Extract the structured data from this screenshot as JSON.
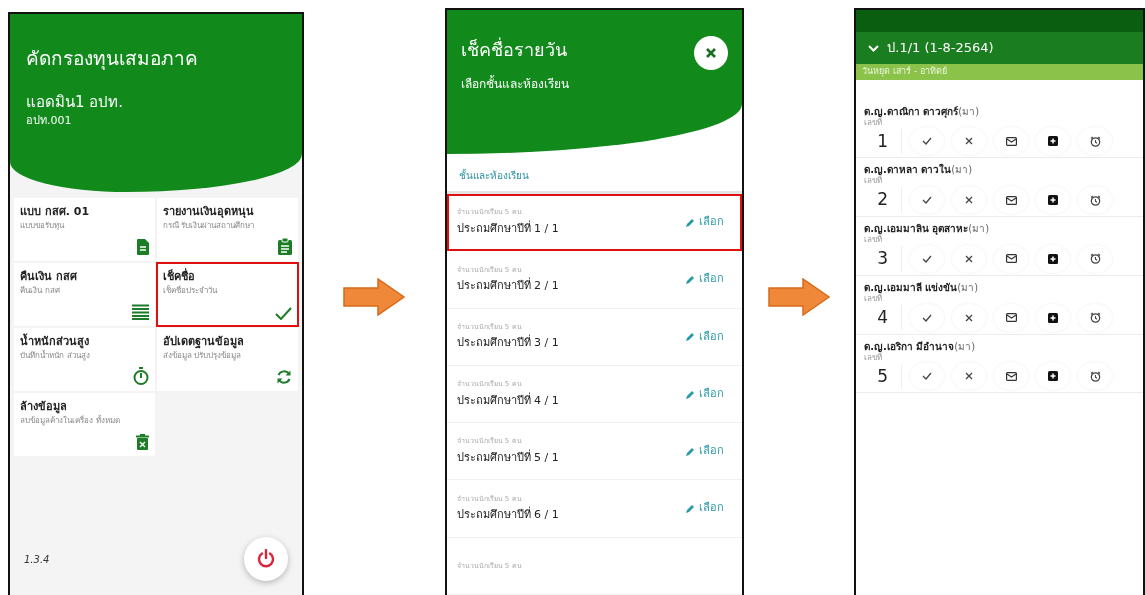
{
  "screens": [
    {
      "kind": "menu",
      "title": "คัดกรองทุนเสมอภาค",
      "user": "แอดมิน1 อปท.",
      "org": "อปท.001",
      "tiles": [
        {
          "title": "แบบ กสศ. 01",
          "subtitle": "แบบขอรับทุน",
          "highlighted": false
        },
        {
          "title": "รายงานเงินอุดหนุน",
          "subtitle": "กรณี รับเงินผ่านสถานศึกษา",
          "highlighted": false
        },
        {
          "title": "คืนเงิน กสศ",
          "subtitle": "คืนเงิน กสศ",
          "highlighted": false
        },
        {
          "title": "เช็คชื่อ",
          "subtitle": "เช็คชื่อประจำวัน",
          "highlighted": true
        },
        {
          "title": "น้ำหนักส่วนสูง",
          "subtitle": "บันทึกน้ำหนัก ส่วนสูง",
          "highlighted": false
        },
        {
          "title": "อัปเดตฐานข้อมูล",
          "subtitle": "ส่งข้อมูล ปรับปรุงข้อมูล",
          "highlighted": false
        },
        {
          "title": "ล้างข้อมูล",
          "subtitle": "ลบข้อมูลค้างในเครื่อง ทั้งหมด",
          "highlighted": false
        }
      ],
      "version": "1.3.4"
    },
    {
      "kind": "class_select",
      "title": "เช็คชื่อรายวัน",
      "subtitle": "เลือกชั้นและห้องเรียน",
      "section": "ชั้นและห้องเรียน",
      "classes": [
        {
          "count": "จำนวนนักเรียน 5 คน",
          "name": "ประถมศึกษาปีที่ 1 / 1",
          "action": "เลือก",
          "highlighted": true
        },
        {
          "count": "จำนวนนักเรียน 5 คน",
          "name": "ประถมศึกษาปีที่ 2 / 1",
          "action": "เลือก",
          "highlighted": false
        },
        {
          "count": "จำนวนนักเรียน 5 คน",
          "name": "ประถมศึกษาปีที่ 3 / 1",
          "action": "เลือก",
          "highlighted": false
        },
        {
          "count": "จำนวนนักเรียน 5 คน",
          "name": "ประถมศึกษาปีที่ 4 / 1",
          "action": "เลือก",
          "highlighted": false
        },
        {
          "count": "จำนวนนักเรียน 5 คน",
          "name": "ประถมศึกษาปีที่ 5 / 1",
          "action": "เลือก",
          "highlighted": false
        },
        {
          "count": "จำนวนนักเรียน 5 คน",
          "name": "ประถมศึกษาปีที่ 6 / 1",
          "action": "เลือก",
          "highlighted": false
        },
        {
          "count": "จำนวนนักเรียน 5 คน",
          "highlighted": false
        }
      ]
    },
    {
      "kind": "attendance",
      "header": "ป.1/1 (1-8-2564)",
      "note": "วันหยุด เสาร์ - อาทิตย์",
      "students": [
        {
          "name": "ด.ญ.ดาณิกา ดาวศุกร์",
          "status": "(มา)",
          "number_label": "เลขที่",
          "number": "1"
        },
        {
          "name": "ด.ญ.ดาหลา ดาวใน",
          "status": "(มา)",
          "number_label": "เลขที่",
          "number": "2"
        },
        {
          "name": "ด.ญ.เอมมาลิน อุตสาหะ",
          "status": "(มา)",
          "number_label": "เลขที่",
          "number": "3"
        },
        {
          "name": "ด.ญ.เอมมาลี แข่งขัน",
          "status": "(มา)",
          "number_label": "เลขที่",
          "number": "4"
        },
        {
          "name": "ด.ญ.เอริกา มีอำนาจ",
          "status": "(มา)",
          "number_label": "เลขที่",
          "number": "5"
        }
      ]
    }
  ]
}
